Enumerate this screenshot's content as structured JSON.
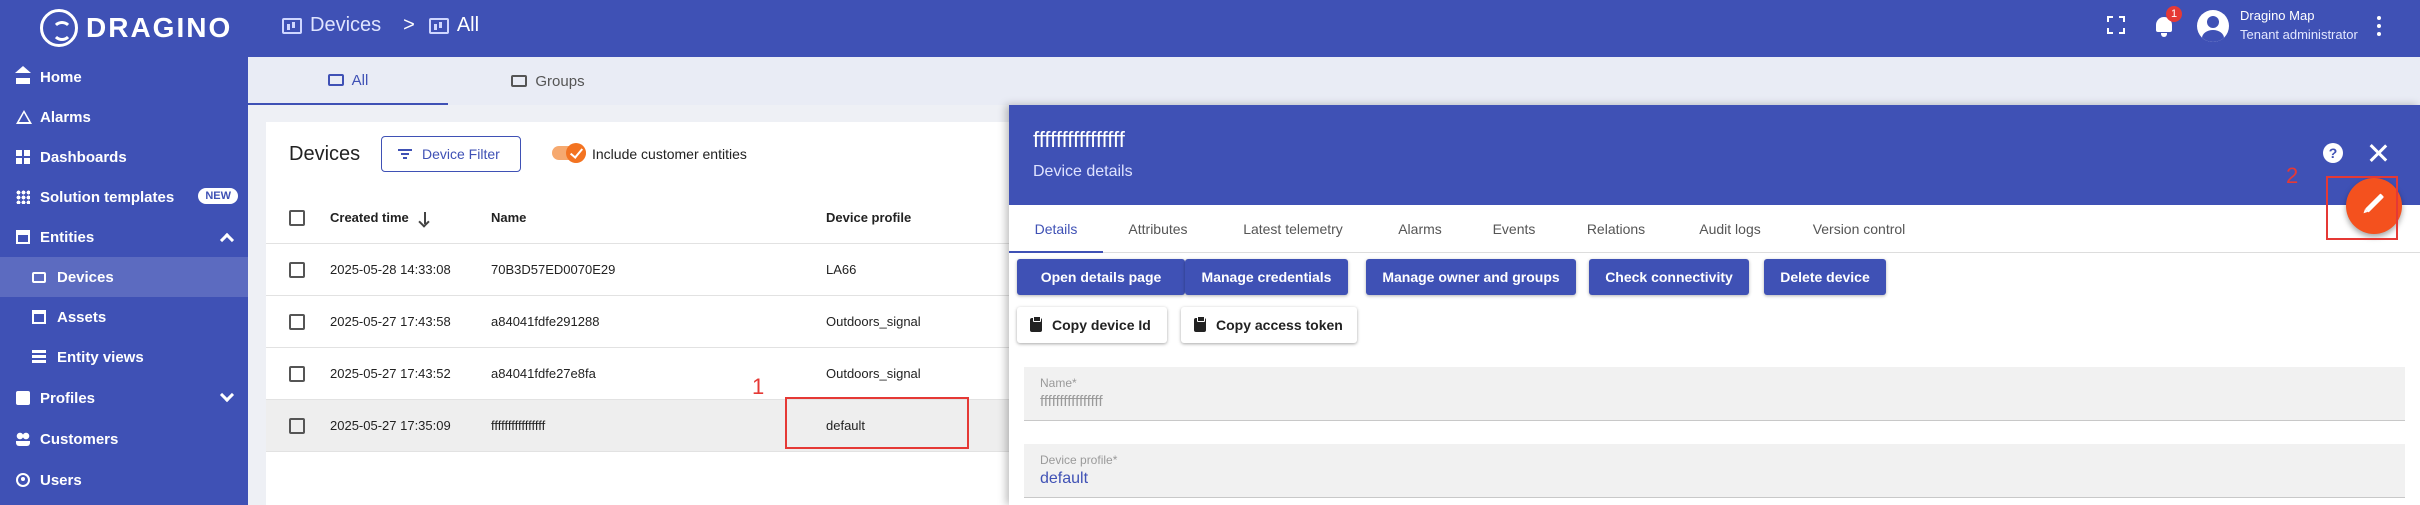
{
  "header": {
    "logo_text": "DRAGINO",
    "breadcrumb": [
      {
        "label": "Devices"
      },
      {
        "label": "All"
      }
    ],
    "breadcrumb_separator": ">",
    "notification_count": "1",
    "user_name": "Dragino Map",
    "user_role": "Tenant administrator",
    "icons": [
      "fullscreen-icon",
      "bell-icon",
      "avatar-icon",
      "more-vert-icon"
    ]
  },
  "sidebar": {
    "items": [
      {
        "label": "Home",
        "icon": "home-icon"
      },
      {
        "label": "Alarms",
        "icon": "alarm-icon"
      },
      {
        "label": "Dashboards",
        "icon": "dashboard-icon"
      },
      {
        "label": "Solution templates",
        "icon": "apps-icon",
        "badge": "NEW"
      },
      {
        "label": "Entities",
        "icon": "entities-icon",
        "expanded": true
      },
      {
        "label": "Devices",
        "icon": "device-icon",
        "active": true
      },
      {
        "label": "Assets",
        "icon": "asset-icon"
      },
      {
        "label": "Entity views",
        "icon": "entity-view-icon"
      },
      {
        "label": "Profiles",
        "icon": "profiles-icon",
        "expanded": false
      },
      {
        "label": "Customers",
        "icon": "customers-icon"
      },
      {
        "label": "Users",
        "icon": "users-icon"
      }
    ]
  },
  "tabs": [
    {
      "label": "All",
      "active": true
    },
    {
      "label": "Groups"
    }
  ],
  "list": {
    "title": "Devices",
    "filter_button": "Device Filter",
    "include_customer_label": "Include customer entities",
    "include_customer_enabled": true,
    "columns": [
      "Created time",
      "Name",
      "Device profile"
    ],
    "rows": [
      {
        "created": "2025-05-28 14:33:08",
        "name": "70B3D57ED0070E29",
        "profile": "LA66"
      },
      {
        "created": "2025-05-27 17:43:58",
        "name": "a84041fdfe291288",
        "profile": "Outdoors_signal"
      },
      {
        "created": "2025-05-27 17:43:52",
        "name": "a84041fdfe27e8fa",
        "profile": "Outdoors_signal"
      },
      {
        "created": "2025-05-27 17:35:09",
        "name": "ffffffffffffffff",
        "profile": "default",
        "highlighted": true
      }
    ]
  },
  "detail": {
    "title": "ffffffffffffffff",
    "subtitle": "Device details",
    "tabs": [
      "Details",
      "Attributes",
      "Latest telemetry",
      "Alarms",
      "Events",
      "Relations",
      "Audit logs",
      "Version control"
    ],
    "active_tab": "Details",
    "actions": [
      "Open details page",
      "Manage credentials",
      "Manage owner and groups",
      "Check connectivity",
      "Delete device"
    ],
    "copy_actions": [
      "Copy device Id",
      "Copy access token"
    ],
    "fields": [
      {
        "label": "Name*",
        "value": "ffffffffffffffff"
      },
      {
        "label": "Device profile*",
        "value": "default"
      }
    ]
  },
  "annotations": [
    "1",
    "2"
  ],
  "colors": {
    "primary": "#3f51b5",
    "accent": "#f4511e",
    "annotation": "#e53935"
  }
}
